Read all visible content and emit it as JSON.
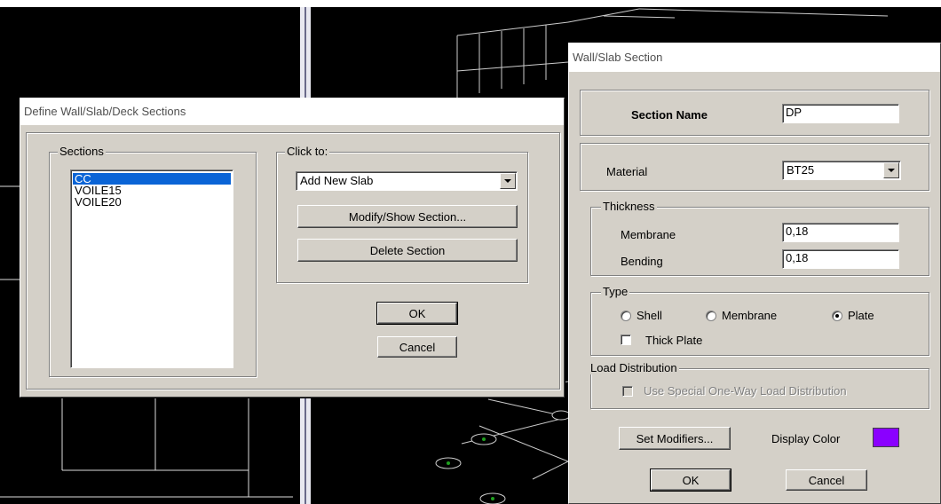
{
  "define_dialog": {
    "title": "Define Wall/Slab/Deck Sections",
    "sections_group_label": "Sections",
    "sections": [
      {
        "name": "CC",
        "selected": true
      },
      {
        "name": "VOILE15",
        "selected": false
      },
      {
        "name": "VOILE20",
        "selected": false
      }
    ],
    "click_to_group_label": "Click to:",
    "click_to_combo_value": "Add New Slab",
    "modify_button": "Modify/Show Section...",
    "delete_button": "Delete Section",
    "ok_button": "OK",
    "cancel_button": "Cancel"
  },
  "wallslab_dialog": {
    "title": "Wall/Slab Section",
    "section_name_label": "Section Name",
    "section_name_value": "DP",
    "material_label": "Material",
    "material_value": "BT25",
    "thickness_group_label": "Thickness",
    "membrane_label": "Membrane",
    "membrane_value": "0,18",
    "bending_label": "Bending",
    "bending_value": "0,18",
    "type_group_label": "Type",
    "type_options": {
      "shell": "Shell",
      "membrane": "Membrane",
      "plate": "Plate"
    },
    "type_selected": "Plate",
    "thick_plate_label": "Thick Plate",
    "load_distribution_group_label": "Load Distribution",
    "special_one_way_label": "Use Special One-Way Load Distribution",
    "set_modifiers_button": "Set Modifiers...",
    "display_color_label": "Display Color",
    "display_color": "#8a00ff",
    "ok_button": "OK",
    "cancel_button": "Cancel"
  }
}
